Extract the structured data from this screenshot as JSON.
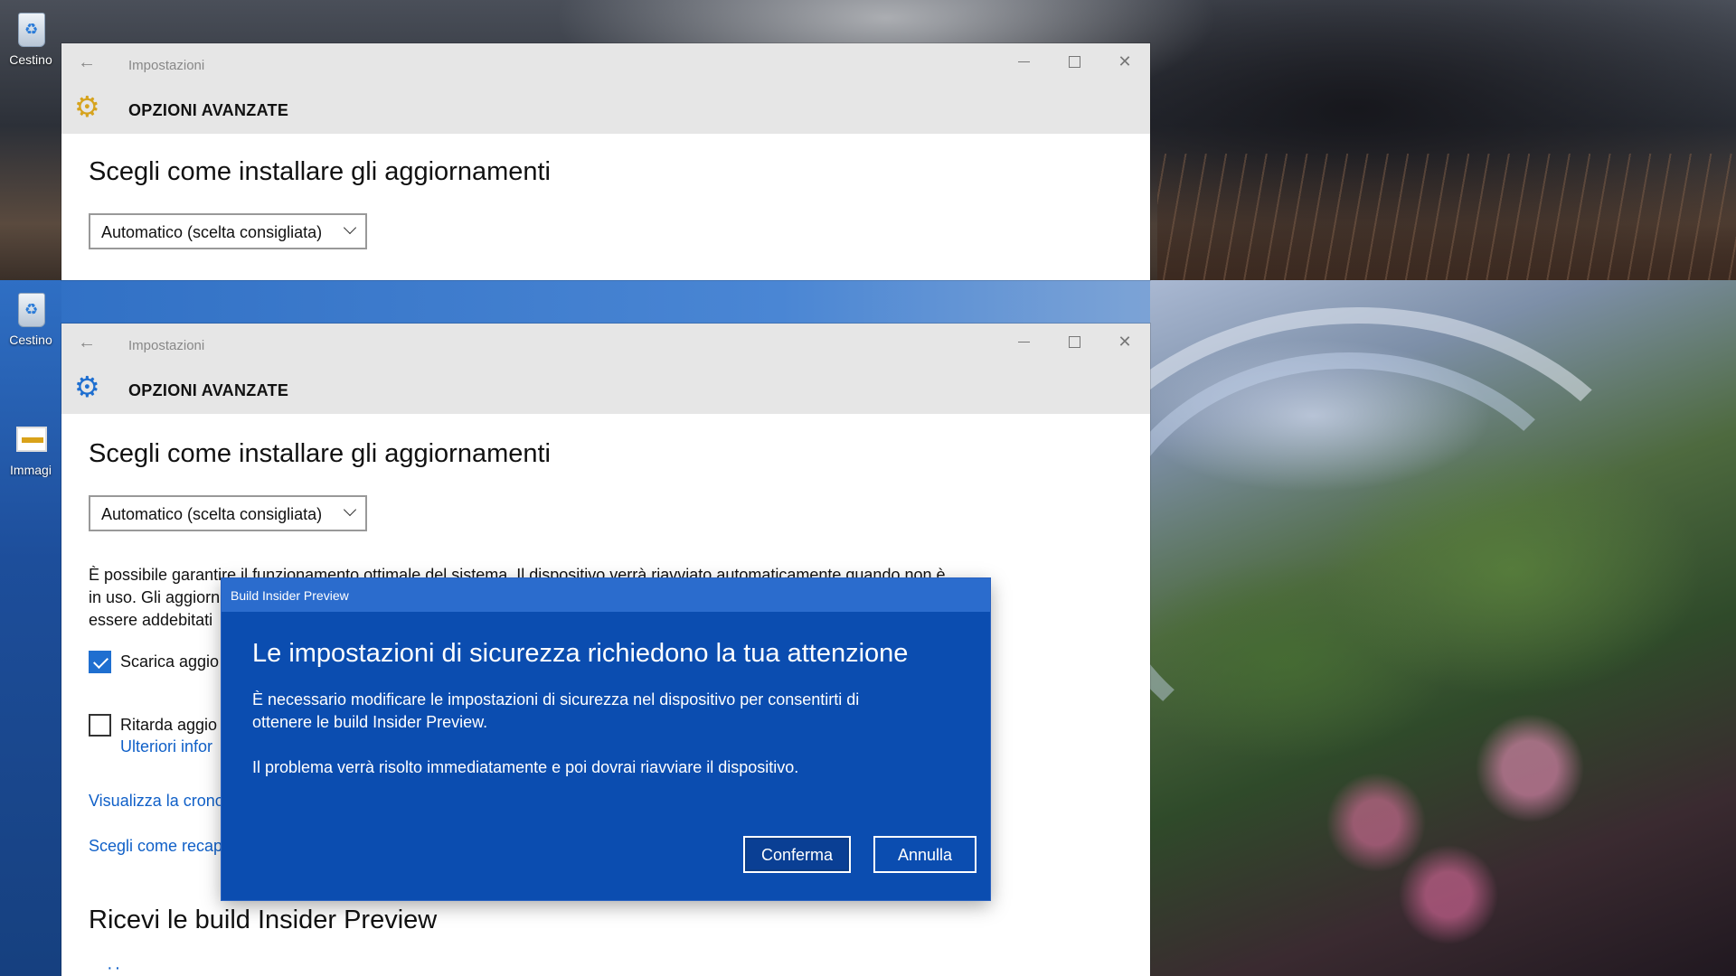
{
  "desktop": {
    "icons": [
      {
        "label": "Cestino"
      },
      {
        "label": "Cestino"
      },
      {
        "label": "Immagi"
      }
    ]
  },
  "window_back": {
    "app_title": "Impostazioni",
    "header_title": "OPZIONI AVANZATE",
    "section_title": "Scegli come installare gli aggiornamenti",
    "dropdown_value": "Automatico (scelta consigliata)"
  },
  "window_front": {
    "app_title": "Impostazioni",
    "header_title": "OPZIONI AVANZATE",
    "section_title": "Scegli come installare gli aggiornamenti",
    "dropdown_value": "Automatico (scelta consigliata)",
    "description_lines": [
      "È possibile garantire il funzionamento ottimale del sistema. Il dispositivo verrà riavviato automaticamente quando non è",
      "in uso. Gli aggiorn",
      "essere addebitati"
    ],
    "checkbox_download": {
      "label": "Scarica aggio",
      "checked": true
    },
    "checkbox_defer": {
      "label": "Ritarda aggio",
      "checked": false
    },
    "link_more_info": "Ulteriori infor",
    "link_history": "Visualizza la crono",
    "link_delivery": "Scegli come recap",
    "insider_title": "Ricevi le build Insider Preview",
    "loading_dots": "··"
  },
  "dialog": {
    "window_title": "Build Insider Preview",
    "heading": "Le impostazioni di sicurezza richiedono la tua attenzione",
    "paragraph1_line1": "È necessario modificare le impostazioni di sicurezza nel dispositivo per consentirti di",
    "paragraph1_line2": "ottenere le build Insider Preview.",
    "paragraph2": "Il problema verrà risolto immediatamente e poi dovrai riavviare il dispositivo.",
    "confirm_label": "Conferma",
    "cancel_label": "Annulla"
  },
  "icons": {
    "back": "←",
    "close": "✕",
    "gear": "⚙"
  },
  "colors": {
    "dialog_bg": "#0b4db0",
    "dialog_titlebar": "#2b6ccd",
    "link": "#1060c8",
    "checkbox_checked": "#1f6fd0",
    "gear_back": "#d6a31e",
    "gear_front": "#1f6fd0"
  }
}
